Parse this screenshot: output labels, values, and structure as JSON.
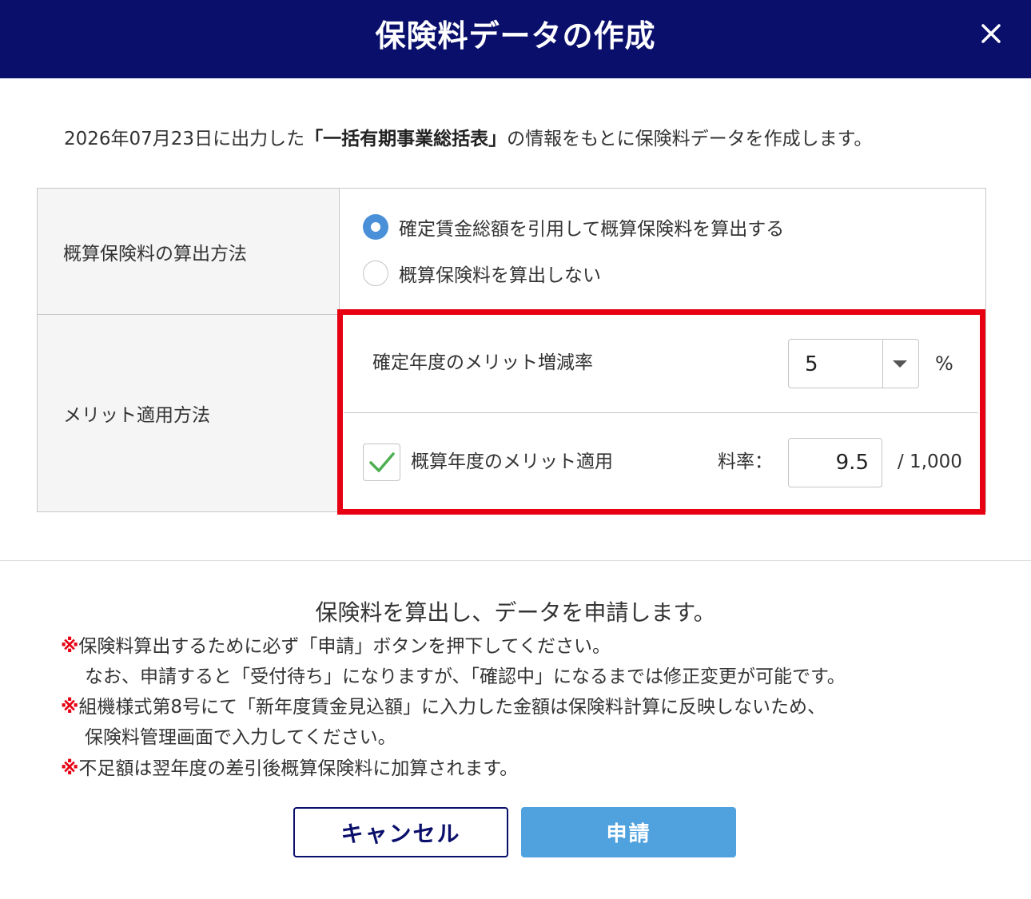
{
  "dialog": {
    "title": "保険料データの作成",
    "close_icon": "close-icon"
  },
  "intro": {
    "prefix": "2026年07月23日に出力した",
    "emphasis": "「一括有期事業総括表」",
    "suffix": "の情報をもとに保険料データを作成します。"
  },
  "form": {
    "calc_method": {
      "label": "概算保険料の算出方法",
      "options": [
        {
          "label": "確定賃金総額を引用して概算保険料を算出する",
          "selected": true
        },
        {
          "label": "概算保険料を算出しない",
          "selected": false
        }
      ]
    },
    "merit": {
      "label": "メリット適用方法",
      "rate_change_label": "確定年度のメリット増減率",
      "rate_change_value": "5",
      "rate_change_unit": "%",
      "apply_label": "概算年度のメリット適用",
      "apply_checked": true,
      "rate_label": "料率：",
      "rate_value": "9.5",
      "rate_unit": "/ 1,000"
    }
  },
  "notice": {
    "heading": "保険料を算出し、データを申請します。",
    "mark": "※",
    "lines": [
      {
        "text": "保険料算出するために必ず「申請」ボタンを押下してください。",
        "marked": true
      },
      {
        "text": "なお、申請すると「受付待ち」になりますが、「確認中」になるまでは修正変更が可能です。",
        "marked": false
      },
      {
        "text": "組機様式第8号にて「新年度賃金見込額」に入力した金額は保険料計算に反映しないため、",
        "marked": true
      },
      {
        "text": "保険料管理画面で入力してください。",
        "marked": false
      },
      {
        "text": "不足額は翌年度の差引後概算保険料に加算されます。",
        "marked": true
      }
    ]
  },
  "buttons": {
    "cancel": "キャンセル",
    "submit": "申請"
  },
  "colors": {
    "header_bg": "#0a0f6b",
    "highlight": "#e60012",
    "submit_bg": "#4fa2de",
    "radio_selected": "#4a90d9",
    "check_mark": "#4caf50"
  }
}
